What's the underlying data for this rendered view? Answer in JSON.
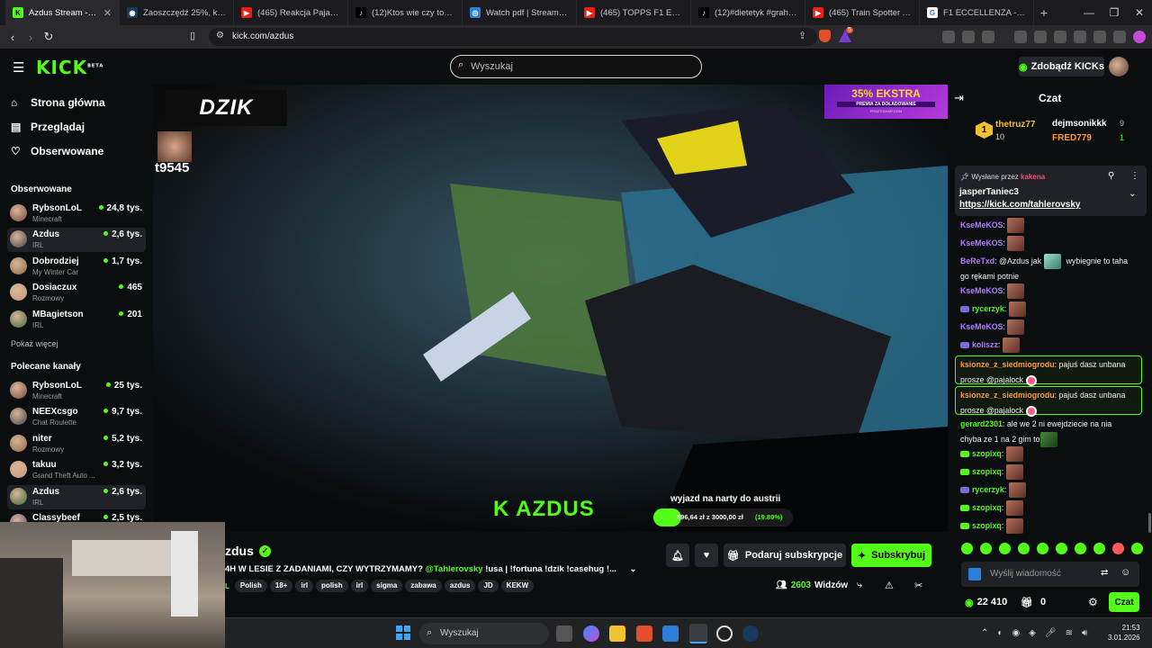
{
  "browser": {
    "tabs": [
      {
        "title": "Azdus Stream - Wa",
        "icon": "kick-icon",
        "active": true
      },
      {
        "title": "Zaoszczędź 25%, kupując",
        "icon": "steam-icon"
      },
      {
        "title": "(465) Reakcja Pajalocka na",
        "icon": "youtube-icon"
      },
      {
        "title": "(12)Ktos wie czy to prawda",
        "icon": "tiktok-icon"
      },
      {
        "title": "Watch pdf | Streamable",
        "icon": "streamable-icon"
      },
      {
        "title": "(465) TOPPS F1 ECCELLENZ",
        "icon": "youtube-icon"
      },
      {
        "title": "(12)#dietetyk #grahamka",
        "icon": "tiktok-icon"
      },
      {
        "title": "(465) Train Spotter Almost",
        "icon": "youtube-icon"
      },
      {
        "title": "F1 ECCELLENZA - Google",
        "icon": "google-icon"
      }
    ],
    "new_tab": "+",
    "url": "kick.com/azdus",
    "shield_count": "5"
  },
  "kick": {
    "logo": "KICK",
    "logo_beta": "BETA",
    "search_placeholder": "Wyszukaj",
    "get_kicks": "Zdobądź KICKs"
  },
  "sidebar": {
    "nav": [
      {
        "label": "Strona główna",
        "icon": "home-icon"
      },
      {
        "label": "Przeglądaj",
        "icon": "browse-icon"
      },
      {
        "label": "Obserwowane",
        "icon": "heart-icon"
      }
    ],
    "followed_title": "Obserwowane",
    "followed": [
      {
        "name": "RybsonLoL",
        "category": "Minecraft",
        "viewers": "24,8 tys."
      },
      {
        "name": "Azdus",
        "category": "IRL",
        "viewers": "2,6 tys."
      },
      {
        "name": "Dobrodziej",
        "category": "My Winter Car",
        "viewers": "1,7 tys."
      },
      {
        "name": "Dosiaczux",
        "category": "Rozmowy",
        "viewers": "465"
      },
      {
        "name": "MBagietson",
        "category": "IRL",
        "viewers": "201"
      }
    ],
    "show_more": "Pokaż więcej",
    "recommended_title": "Polecane kanały",
    "recommended": [
      {
        "name": "RybsonLoL",
        "category": "Minecraft",
        "viewers": "25 tys."
      },
      {
        "name": "NEEXcsgo",
        "category": "Chat Roulette",
        "viewers": "9,7 tys."
      },
      {
        "name": "niter",
        "category": "Rozmowy",
        "viewers": "5,2 tys."
      },
      {
        "name": "takuu",
        "category": "Grand Theft Auto ...",
        "viewers": "3,2 tys."
      },
      {
        "name": "Azdus",
        "category": "IRL",
        "viewers": "2,6 tys."
      },
      {
        "name": "Classybeef",
        "category": "",
        "viewers": "2,5 tys."
      }
    ]
  },
  "video": {
    "sponsor_logo": "DZIK",
    "overlay_id": "t9545",
    "ad_text": "35% EKSTRA",
    "ad_sub": "PREMIA ZA DOŁADOWANIE",
    "ad_small": "PIRATESHAR.COM",
    "streamer_tag": "K AZDUS",
    "goal_title": "wyjazd na narty do austrii",
    "goal_text": "596,64 zł z 3000,00 zł",
    "goal_pct": "(19.89%)",
    "goal_fraction": 0.1989
  },
  "stream": {
    "name": "zdus",
    "title": "4H W LESIE Z ZADANIAMI, CZY WYTRZYMAMY?",
    "mention": "@Tahlerovsky",
    "title_rest": "!usa | !fortuna !dzik !casehug !...",
    "lang_prefix": "L",
    "tags": [
      "Polish",
      "18+",
      "irl",
      "polish",
      "irl",
      "sigma",
      "zabawa",
      "azdus",
      "JD",
      "KEKW"
    ],
    "gift_sub": "Podaruj subskrypcje",
    "subscribe": "Subskrybuj",
    "viewers": "2603",
    "viewers_label": "Widzów"
  },
  "chat": {
    "title": "Czat",
    "leaderboard": [
      {
        "rank": "1",
        "name": "thetruz77",
        "count": "10"
      },
      {
        "name": "dejmsonikkk",
        "count": "9"
      },
      {
        "name": "FRED779",
        "count": "1"
      }
    ],
    "pinned_by_label": "Wysłane przez",
    "pinned_by": "kakena",
    "pinned_user": "jasperTaniec3",
    "pinned_link": "https://kick.com/tahlerovsky",
    "messages": [
      {
        "user": "KseMeKOS",
        "text": "",
        "color": "#b57cff",
        "emote": true
      },
      {
        "user": "KseMeKOS",
        "text": "",
        "color": "#b57cff",
        "emote": true
      },
      {
        "user": "BeReTxd",
        "text": "@Azdus jak",
        "text2": "wybiegnie to taha",
        "text3": "go rękami potnie",
        "color": "#b57cff"
      },
      {
        "user": "KseMeKOS",
        "text": "",
        "color": "#b57cff",
        "emote": true
      },
      {
        "user": "rycerzyk",
        "text": "",
        "color": "#53fc18",
        "emote": true
      },
      {
        "user": "KseMeKOS",
        "text": "",
        "color": "#b57cff",
        "emote": true
      },
      {
        "user": "koliszz",
        "text": "",
        "color": "#b57cff",
        "emote": true
      },
      {
        "user": "ksionze_z_siedmiogrodu",
        "text": "pajuś dasz unbana",
        "text2": "prosze @pajalock",
        "color": "#ff9a3c"
      },
      {
        "user": "ksionze_z_siedmiogrodu",
        "text": "pajuś dasz unbana",
        "text2": "prosze @pajalock",
        "color": "#ff9a3c"
      },
      {
        "user": "gerard2301",
        "text": "ale we 2 ni ewejdziecie na nia",
        "text2": "chyba ze 1 na 2 gim to",
        "color": "#53fc18"
      },
      {
        "user": "szopixq",
        "text": "",
        "color": "#53fc18",
        "emote": true
      },
      {
        "user": "szopixq",
        "text": "",
        "color": "#53fc18",
        "emote": true
      },
      {
        "user": "rycerzyk",
        "text": "",
        "color": "#53fc18",
        "emote": true
      },
      {
        "user": "szopixq",
        "text": "",
        "color": "#53fc18",
        "emote": true
      },
      {
        "user": "szopixq",
        "text": "",
        "color": "#53fc18",
        "emote": true
      }
    ],
    "input_placeholder": "Wyślij wiadomość",
    "kicks": "22 410",
    "gifts": "0",
    "send": "Czat"
  },
  "taskbar": {
    "search": "Wyszukaj",
    "time": "21:53",
    "date": "3.01.2026"
  }
}
